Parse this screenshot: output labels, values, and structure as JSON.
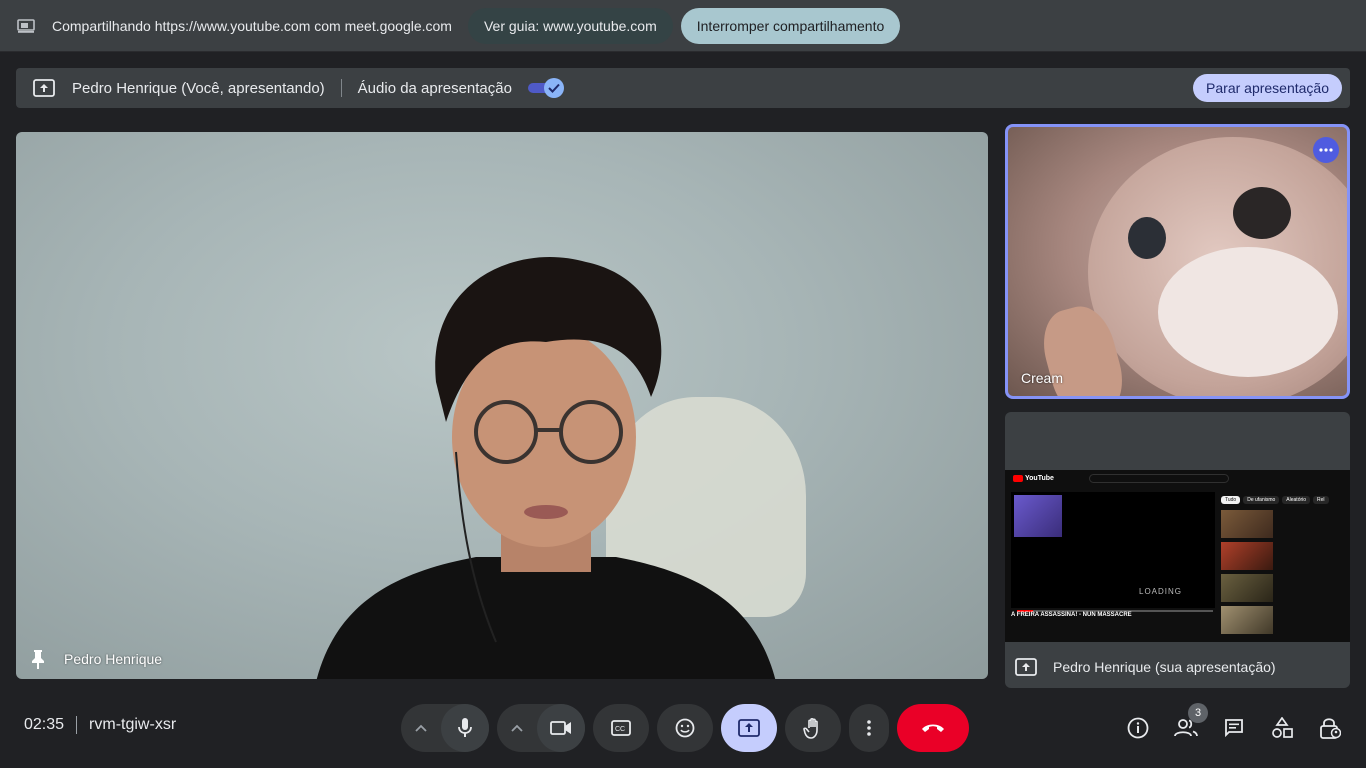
{
  "sharebar": {
    "message": "Compartilhando https://www.youtube.com com meet.google.com",
    "view_tab_label": "Ver guia: www.youtube.com",
    "stop_sharing_label": "Interromper compartilhamento"
  },
  "presenting": {
    "presenter_label": "Pedro Henrique (Você, apresentando)",
    "audio_label": "Áudio da apresentação",
    "audio_enabled": true,
    "stop_label": "Parar apresentação"
  },
  "main_tile": {
    "participant_name": "Pedro Henrique"
  },
  "side_tile": {
    "participant_name": "Cream",
    "highlight_color": "#8593f7"
  },
  "presentation_tile": {
    "label": "Pedro Henrique (sua apresentação)",
    "preview": {
      "site_logo": "YouTube",
      "player_status": "LOADING",
      "video_title": "A FREIRA ASSASSINA! - NUN MASSACRE",
      "chips": [
        "Tudo",
        "De ufanismo",
        "Aleatório",
        "Rel"
      ]
    }
  },
  "bottom": {
    "time": "02:35",
    "meeting_code": "rvm-tgiw-xsr",
    "participants_count": "3"
  },
  "colors": {
    "accent": "#c5cdfd",
    "hangup": "#ea0027",
    "background": "#202124"
  }
}
